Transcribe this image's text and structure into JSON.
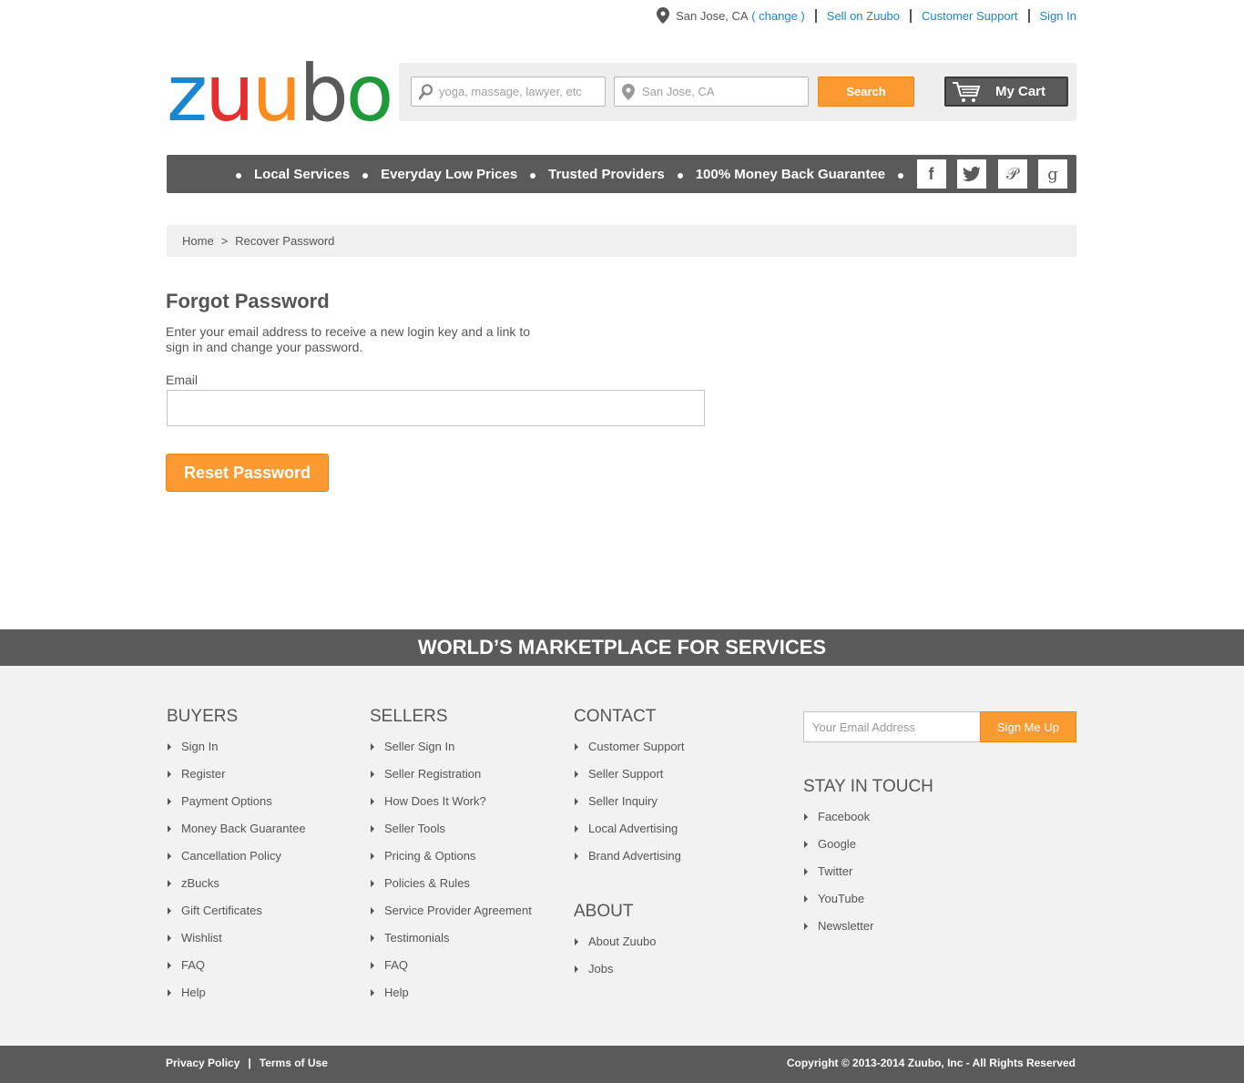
{
  "topbar": {
    "location": "San Jose, CA",
    "change": "( change )",
    "sell": "Sell on Zuubo",
    "support": "Customer Support",
    "signin": "Sign In"
  },
  "logo": {
    "letters": [
      "z",
      "u",
      "u",
      "b",
      "o"
    ],
    "colors": [
      "#1a86d0",
      "#e62e2e",
      "#fb8c1e",
      "#5a5a5a",
      "#1e9a3a"
    ]
  },
  "search": {
    "query_placeholder": "yoga, massage, lawyer, etc",
    "location_placeholder": "San Jose, CA",
    "button": "Search",
    "cart": "My Cart"
  },
  "nav": {
    "items": [
      "Local Services",
      "Everyday Low Prices",
      "Trusted Providers",
      "100% Money Back Guarantee"
    ],
    "social": [
      "facebook-icon",
      "twitter-icon",
      "pinterest-icon",
      "google-icon"
    ]
  },
  "breadcrumb": {
    "home": "Home",
    "sep": ">",
    "current": "Recover Password"
  },
  "main": {
    "title": "Forgot Password",
    "description": "Enter your email address to receive a new login key and a link to sign in and change your password.",
    "email_label": "Email",
    "email_value": "",
    "reset_button": "Reset Password"
  },
  "band": "WORLD’S MARKETPLACE FOR SERVICES",
  "footer": {
    "buyers": {
      "title": "BUYERS",
      "items": [
        "Sign In",
        "Register",
        "Payment Options",
        "Money Back Guarantee",
        "Cancellation Policy",
        "zBucks",
        "Gift Certificates",
        "Wishlist",
        "FAQ",
        "Help"
      ]
    },
    "sellers": {
      "title": "SELLERS",
      "items": [
        "Seller Sign In",
        "Seller Registration",
        "How Does It Work?",
        "Seller Tools",
        "Pricing & Options",
        "Policies & Rules",
        "Service Provider Agreement",
        "Testimonials",
        "FAQ",
        "Help"
      ]
    },
    "contact": {
      "title": "CONTACT",
      "items": [
        "Customer Support",
        "Seller Support",
        "Seller Inquiry",
        "Local Advertising",
        "Brand Advertising"
      ]
    },
    "about": {
      "title": "ABOUT",
      "items": [
        "About Zuubo",
        "Jobs"
      ]
    },
    "newsletter": {
      "placeholder": "Your Email Address",
      "button": "Sign Me Up"
    },
    "stay": {
      "title": "STAY IN TOUCH",
      "items": [
        "Facebook",
        "Google",
        "Twitter",
        "YouTube",
        "Newsletter"
      ]
    }
  },
  "bottom": {
    "privacy": "Privacy Policy",
    "sep": "|",
    "terms": "Terms of Use",
    "copyright": "Copyright © 2013-2014 Zuubo, Inc - All Rights Reserved"
  }
}
